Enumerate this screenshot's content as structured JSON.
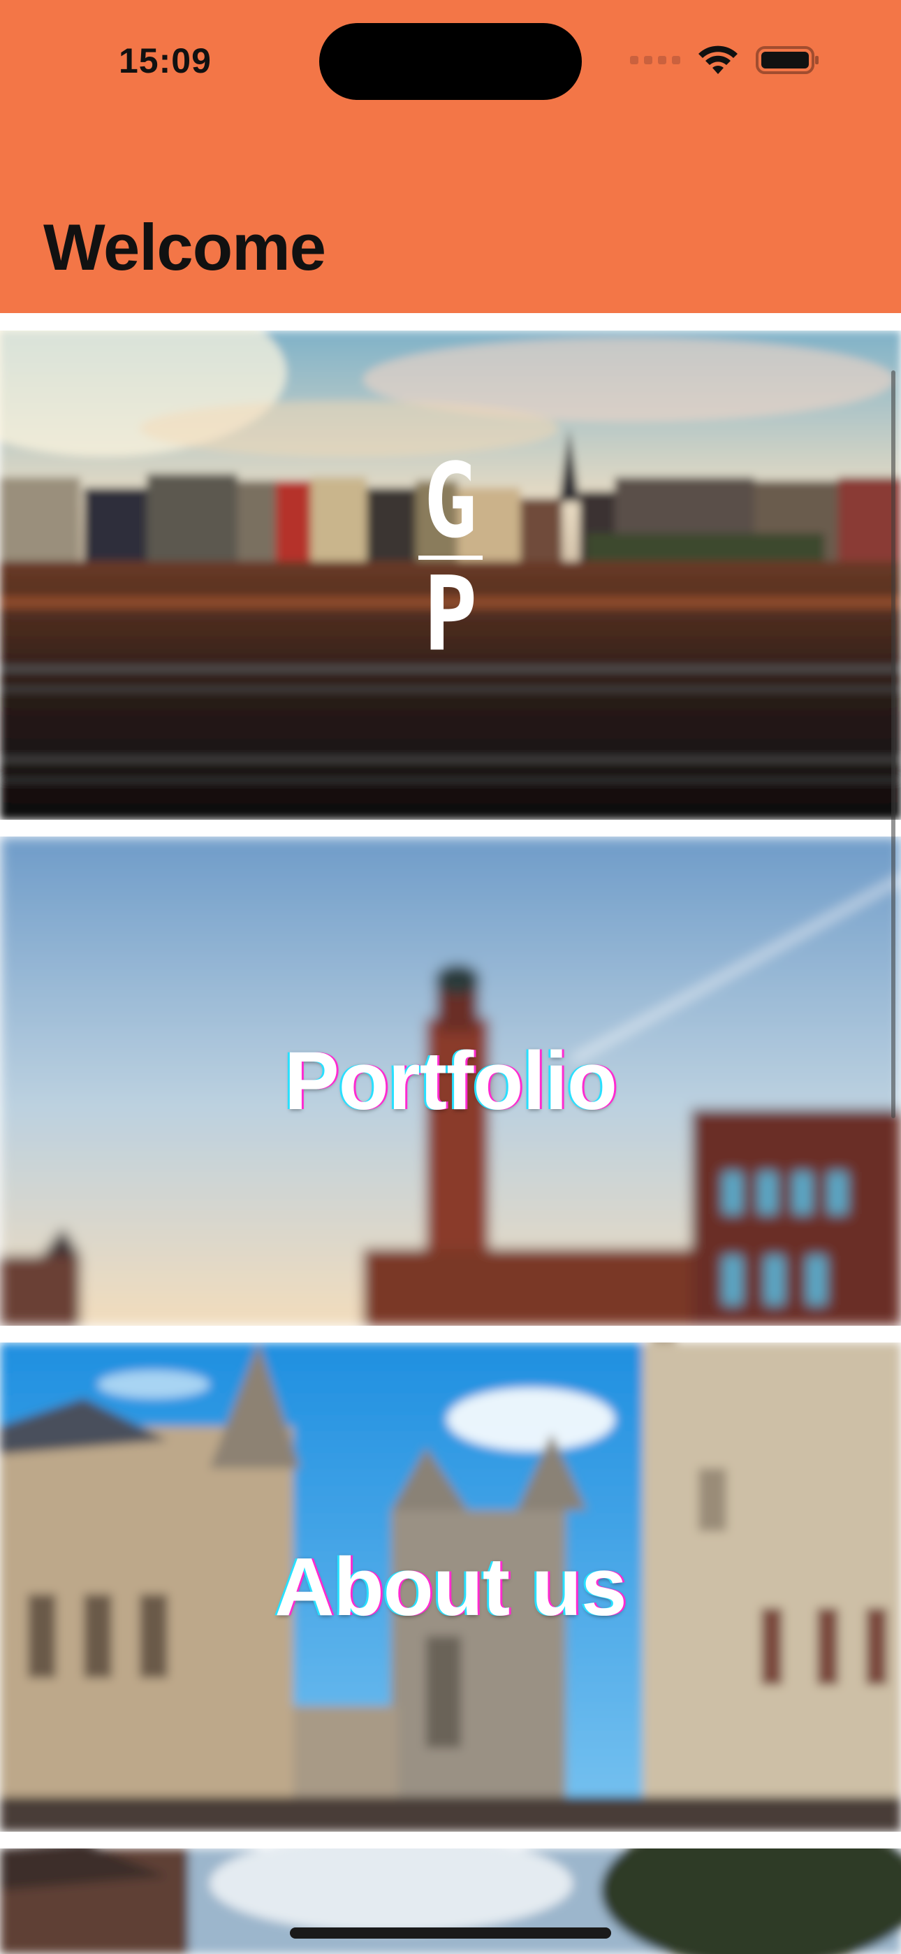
{
  "status_bar": {
    "time": "15:09",
    "icons": [
      "cellular-signal-icon",
      "wifi-icon",
      "battery-icon"
    ]
  },
  "header": {
    "title": "Welcome",
    "background_color": "#F37647"
  },
  "cards": [
    {
      "kind": "logo",
      "logo_top": "G",
      "logo_bottom": "P"
    },
    {
      "kind": "link",
      "label": "Portfolio"
    },
    {
      "kind": "link",
      "label": "About us"
    },
    {
      "kind": "link",
      "label": ""
    }
  ]
}
